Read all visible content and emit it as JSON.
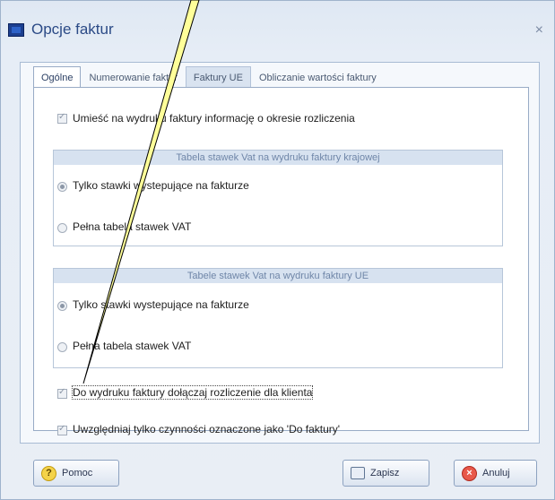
{
  "window": {
    "title": "Opcje faktur",
    "close_glyph": "×",
    "icon": "app-icon"
  },
  "tabs": [
    {
      "label": "Ogólne",
      "state": "active"
    },
    {
      "label": "Numerowanie faktur",
      "state": "normal"
    },
    {
      "label": "Faktury UE",
      "state": "highlighted"
    },
    {
      "label": "Obliczanie wartości faktury",
      "state": "normal"
    }
  ],
  "options": {
    "period_info": {
      "label": "Umieść na wydruku faktury informację o okresie rozliczenia",
      "checked": true
    },
    "domestic_group": {
      "title": "Tabela stawek Vat na wydruku faktury krajowej",
      "radio_only": "Tylko stawki wystepujące na fakturze",
      "radio_full": "Pełna tabela stawek VAT",
      "selected": "radio_only"
    },
    "eu_group": {
      "title": "Tabele stawek Vat na wydruku faktury UE",
      "radio_only": "Tylko stawki wystepujące na fakturze",
      "radio_full": "Pełna tabela stawek VAT",
      "selected": "radio_only"
    },
    "client_settlement": {
      "label": "Do wydruku faktury dołączaj rozliczenie dla klienta",
      "checked": true
    },
    "only_marked": {
      "label": "Uwzględniaj tylko czynności oznaczone jako 'Do faktury'",
      "checked": true
    }
  },
  "buttons": {
    "help": "Pomoc",
    "save": "Zapisz",
    "cancel": "Anuluj"
  },
  "colors": {
    "annotation_fill": "#ffff99",
    "annotation_stroke": "#000000"
  }
}
